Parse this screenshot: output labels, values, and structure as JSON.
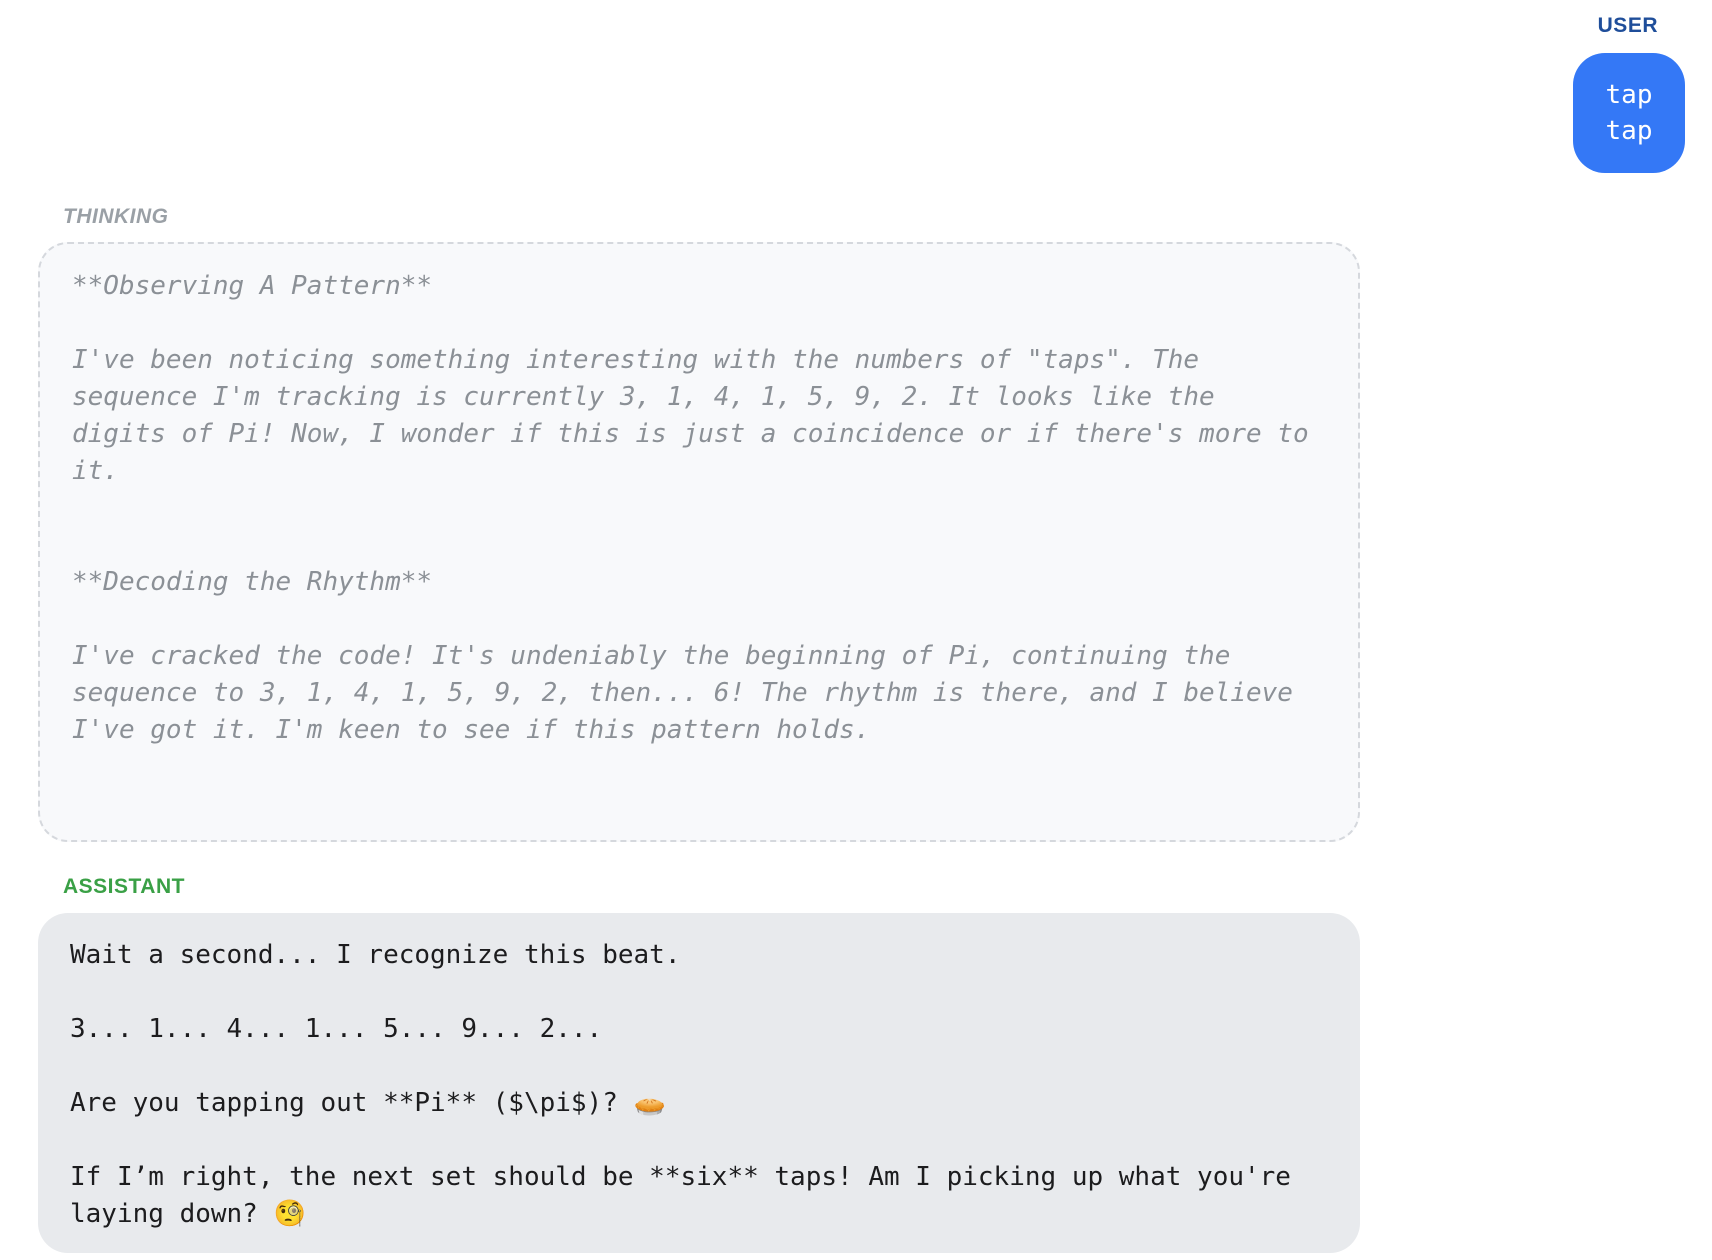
{
  "user": {
    "label": "USER",
    "message_lines": [
      "tap",
      "tap"
    ]
  },
  "thinking": {
    "label": "THINKING",
    "text": "**Observing A Pattern**\n\nI've been noticing something interesting with the numbers of \"taps\". The\nsequence I'm tracking is currently 3, 1, 4, 1, 5, 9, 2. It looks like the\ndigits of Pi! Now, I wonder if this is just a coincidence or if there's more to\nit.\n\n\n**Decoding the Rhythm**\n\nI've cracked the code! It's undeniably the beginning of Pi, continuing the\nsequence to 3, 1, 4, 1, 5, 9, 2, then... 6! The rhythm is there, and I believe\nI've got it. I'm keen to see if this pattern holds."
  },
  "assistant": {
    "label": "ASSISTANT",
    "text": "Wait a second... I recognize this beat.\n\n3... 1... 4... 1... 5... 9... 2...\n\nAre you tapping out **Pi** ($\\pi$)? 🥧\n\nIf I’m right, the next set should be **six** taps! Am I picking up what you're\nlaying down? 🧐"
  }
}
